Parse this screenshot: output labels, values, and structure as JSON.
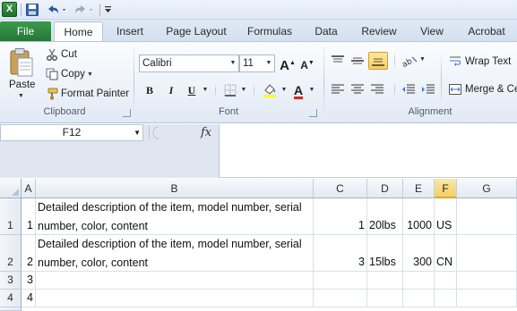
{
  "quick_access": {
    "app_logo": "X",
    "icons": [
      "save-icon",
      "undo-icon",
      "redo-icon",
      "customize-icon"
    ]
  },
  "tabs": {
    "file": "File",
    "items": [
      "Home",
      "Insert",
      "Page Layout",
      "Formulas",
      "Data",
      "Review",
      "View",
      "Acrobat"
    ]
  },
  "ribbon": {
    "clipboard": {
      "paste": "Paste",
      "cut": "Cut",
      "copy": "Copy",
      "format_painter": "Format Painter",
      "label": "Clipboard"
    },
    "font": {
      "name": "Calibri",
      "size": "11",
      "bold": "B",
      "italic": "I",
      "underline": "U",
      "grow": "A",
      "shrink": "A",
      "font_color_letter": "A",
      "label": "Font"
    },
    "alignment": {
      "wrap_text": "Wrap Text",
      "merge": "Merge & Ce",
      "label": "Alignment"
    }
  },
  "formula_bar": {
    "name_box": "F12",
    "fx": "fx",
    "value": ""
  },
  "grid": {
    "columns": [
      "A",
      "B",
      "C",
      "D",
      "E",
      "F",
      "G"
    ],
    "selected_column": "F",
    "rows": [
      {
        "header": "1",
        "cells": [
          "1",
          "Detailed description of the item, model number, serial number, color, content",
          "1",
          "20lbs",
          "1000",
          "US",
          ""
        ]
      },
      {
        "header": "2",
        "cells": [
          "2",
          "Detailed description of the item, model number, serial number, color, content",
          "3",
          "15lbs",
          "300",
          "CN",
          ""
        ]
      },
      {
        "header": "3",
        "cells": [
          "3",
          "",
          "",
          "",
          "",
          "",
          ""
        ]
      },
      {
        "header": "4",
        "cells": [
          "4",
          "",
          "",
          "",
          "",
          "",
          ""
        ]
      }
    ]
  },
  "colors": {
    "file_tab": "#23773a",
    "selected_header": "#f4d064",
    "ribbon_bg": "#eef3fa"
  }
}
